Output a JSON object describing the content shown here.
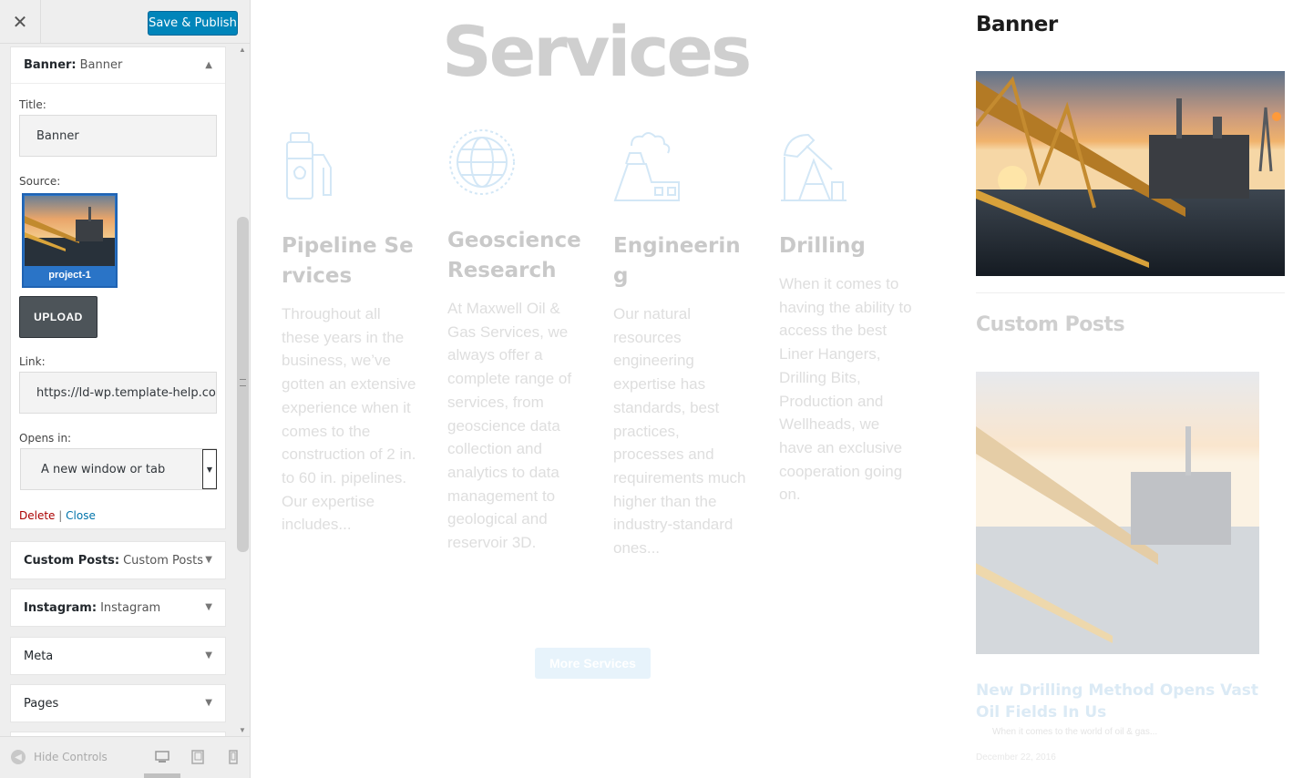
{
  "header": {
    "close_icon": "close-icon",
    "save_label": "Save & Publish"
  },
  "banner_widget": {
    "type_label": "Banner:",
    "title_label": "Banner",
    "fields": {
      "title_label": "Title:",
      "title_value": "Banner",
      "source_label": "Source:",
      "source_caption": "project-1",
      "upload_label": "UPLOAD",
      "link_label": "Link:",
      "link_value": "https://ld-wp.template-help.com",
      "opens_label": "Opens in:",
      "opens_value": "A new window or tab"
    },
    "delete_label": "Delete",
    "separator": "|",
    "close_label": "Close"
  },
  "widgets": [
    {
      "type": "Custom Posts:",
      "name": "Custom Posts"
    },
    {
      "type": "Instagram:",
      "name": "Instagram"
    },
    {
      "type": "Meta",
      "name": ""
    },
    {
      "type": "Pages",
      "name": ""
    }
  ],
  "footer": {
    "hide_controls_label": "Hide Controls",
    "devices": [
      "desktop-icon",
      "tablet-icon",
      "mobile-icon"
    ]
  },
  "preview": {
    "services_title": "Services",
    "services": [
      {
        "title": "Pipeline Services",
        "text": "Throughout all these years in the business, we’ve gotten an extensive experience when it comes to the construction of 2 in. to 60 in. pipelines. Our expertise includes...",
        "icon": "fuel-pump-icon"
      },
      {
        "title": "Geoscience Research",
        "text": "At Maxwell Oil & Gas Services, we always offer a complete range of services, from geoscience data collection and analytics to data management to geological and reservoir 3D.",
        "icon": "globe-icon"
      },
      {
        "title": "Engineering",
        "text": "Our natural resources engineering expertise has standards, best practices, processes and requirements much higher than the industry-standard ones...",
        "icon": "factory-icon"
      },
      {
        "title": "Drilling",
        "text": "When it comes to having the ability to access the best Liner Hangers, Drilling Bits, Production and Wellheads, we have an exclusive cooperation going on.",
        "icon": "oil-pump-jack-icon"
      }
    ],
    "more_services_label": "More Services",
    "aside": {
      "banner_heading": "Banner",
      "custom_posts_heading": "Custom Posts",
      "post_title": "New Drilling Method Opens Vast Oil Fields In Us",
      "post_excerpt": "When it comes to the world of oil & gas...",
      "post_date": "December 22, 2016"
    }
  },
  "colors": {
    "primary_button": "#0085ba",
    "delete_link": "#aa0000",
    "close_link": "#0073aa",
    "icon_blue": "#d3e7f6"
  }
}
